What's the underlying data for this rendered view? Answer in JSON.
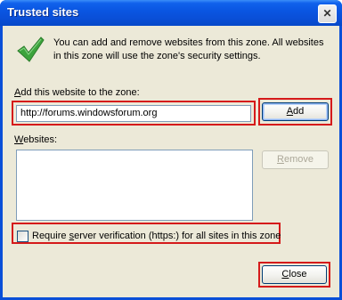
{
  "window": {
    "title": "Trusted sites",
    "close_glyph": "✕"
  },
  "info_text": "You can add and remove websites from this zone. All websites in this zone will use the zone's security settings.",
  "add_site": {
    "label_prefix": "",
    "label_hotkey": "A",
    "label_rest": "dd this website to the zone:",
    "value": "http://forums.windowsforum.org"
  },
  "buttons": {
    "add_hotkey": "A",
    "add_rest": "dd",
    "remove_hotkey": "R",
    "remove_rest": "emove",
    "close_hotkey": "C",
    "close_rest": "lose"
  },
  "websites": {
    "label_hotkey": "W",
    "label_rest": "ebsites:",
    "items": []
  },
  "require_https": {
    "label_prefix": "Require ",
    "label_hotkey": "s",
    "label_rest": "erver verification (https:) for all sites in this zone",
    "checked": false
  },
  "colors": {
    "highlight_box": "#d51a1a",
    "titlebar": "#0a4fd8",
    "dialog_bg": "#ece9d8"
  }
}
